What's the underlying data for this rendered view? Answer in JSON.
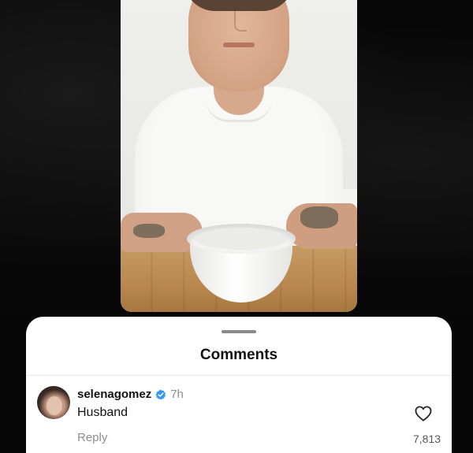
{
  "sheet": {
    "title": "Comments"
  },
  "comment": {
    "username": "selenagomez",
    "verified": true,
    "time": "7h",
    "text": "Husband",
    "reply_label": "Reply",
    "likes": "7,813"
  },
  "icons": {
    "verified": "verified-badge-icon",
    "like": "heart-icon"
  },
  "colors": {
    "verified_blue": "#3897f0",
    "background": "#060606",
    "sheet": "#ffffff"
  }
}
